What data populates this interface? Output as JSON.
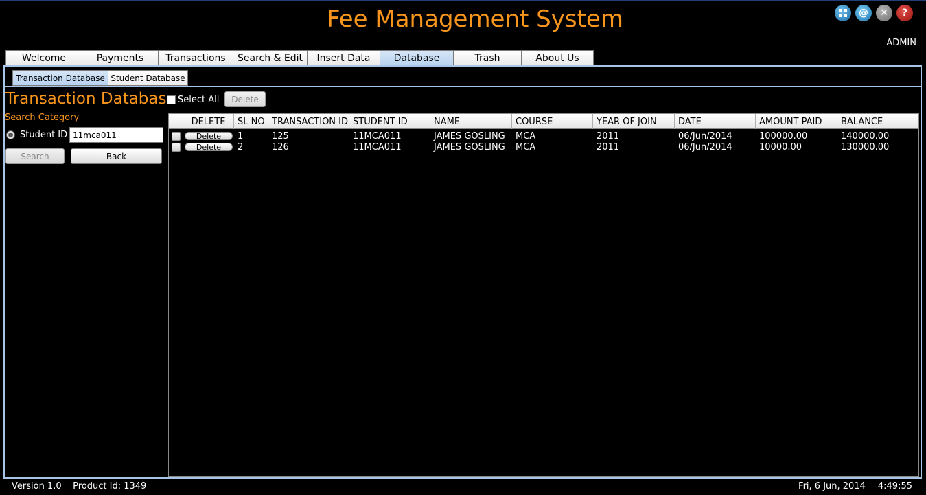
{
  "app": {
    "title": "Fee Management System",
    "user": "ADMIN"
  },
  "window_icons": [
    "grid-icon",
    "at-sign-icon",
    "minimize-icon",
    "help-icon"
  ],
  "main_tabs": [
    {
      "label": "Welcome"
    },
    {
      "label": "Payments"
    },
    {
      "label": "Transactions"
    },
    {
      "label": "Search & Edit"
    },
    {
      "label": "Insert Data"
    },
    {
      "label": "Database",
      "active": true
    },
    {
      "label": "Trash"
    },
    {
      "label": "About Us"
    }
  ],
  "sub_tabs": [
    {
      "label": "Transaction Database",
      "active": true
    },
    {
      "label": "Student Database"
    }
  ],
  "section": {
    "title": "Transaction Database",
    "select_all_label": "Select All",
    "delete_label": "Delete"
  },
  "search": {
    "category_label": "Search Category",
    "field_label": "Student ID",
    "value": "11mca011",
    "search_label": "Search",
    "back_label": "Back"
  },
  "table": {
    "columns": [
      "",
      "DELETE",
      "SL NO",
      "TRANSACTION ID",
      "STUDENT ID",
      "NAME",
      "COURSE",
      "YEAR OF JOIN",
      "DATE",
      "AMOUNT PAID",
      "BALANCE"
    ],
    "row_button_label": "Delete",
    "rows": [
      {
        "sl_no": "1",
        "transaction_id": "125",
        "student_id": "11MCA011",
        "name": "JAMES GOSLING",
        "course": "MCA",
        "year_of_join": "2011",
        "date": "06/Jun/2014",
        "amount_paid": "100000.00",
        "balance": "140000.00"
      },
      {
        "sl_no": "2",
        "transaction_id": "126",
        "student_id": "11MCA011",
        "name": "JAMES GOSLING",
        "course": "MCA",
        "year_of_join": "2011",
        "date": "06/Jun/2014",
        "amount_paid": "10000.00",
        "balance": "130000.00"
      }
    ]
  },
  "footer": {
    "version": "Version 1.0",
    "product_id": "Product Id: 1349",
    "date": "Fri, 6 Jun, 2014",
    "time": "4:49:55"
  },
  "colors": {
    "accent": "#f7951d",
    "background": "#000000",
    "tab_active": "#c6dcf2"
  }
}
